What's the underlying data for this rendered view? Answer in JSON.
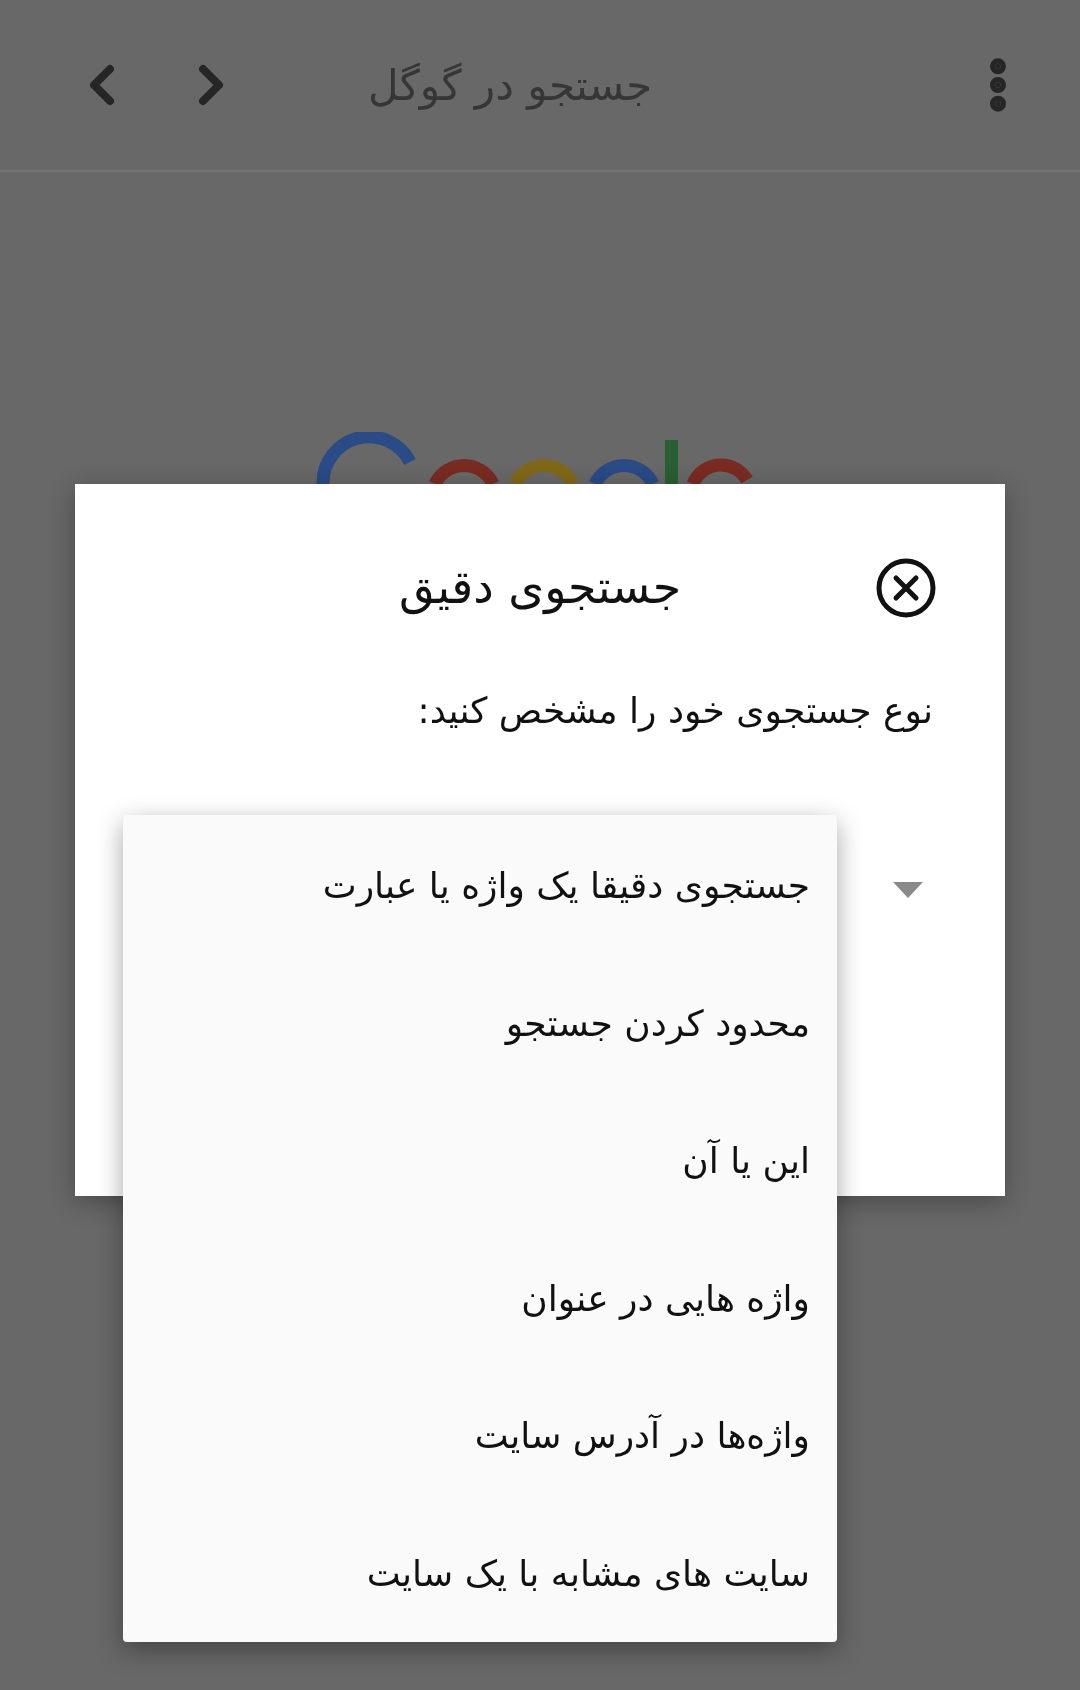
{
  "top_bar": {
    "title": "جستجو در گوگل"
  },
  "dialog": {
    "title": "جستجوی دقیق",
    "prompt": "نوع جستجوی خود را مشخص کنید:",
    "dropdown": {
      "expanded": true,
      "options": [
        "جستجوی دقیقا یک واژه یا عبارت",
        "محدود کردن جستجو",
        "این یا آن",
        "واژه هایی در عنوان",
        "واژه‌ها در آدرس سایت",
        "سایت های مشابه با یک سایت"
      ]
    }
  }
}
